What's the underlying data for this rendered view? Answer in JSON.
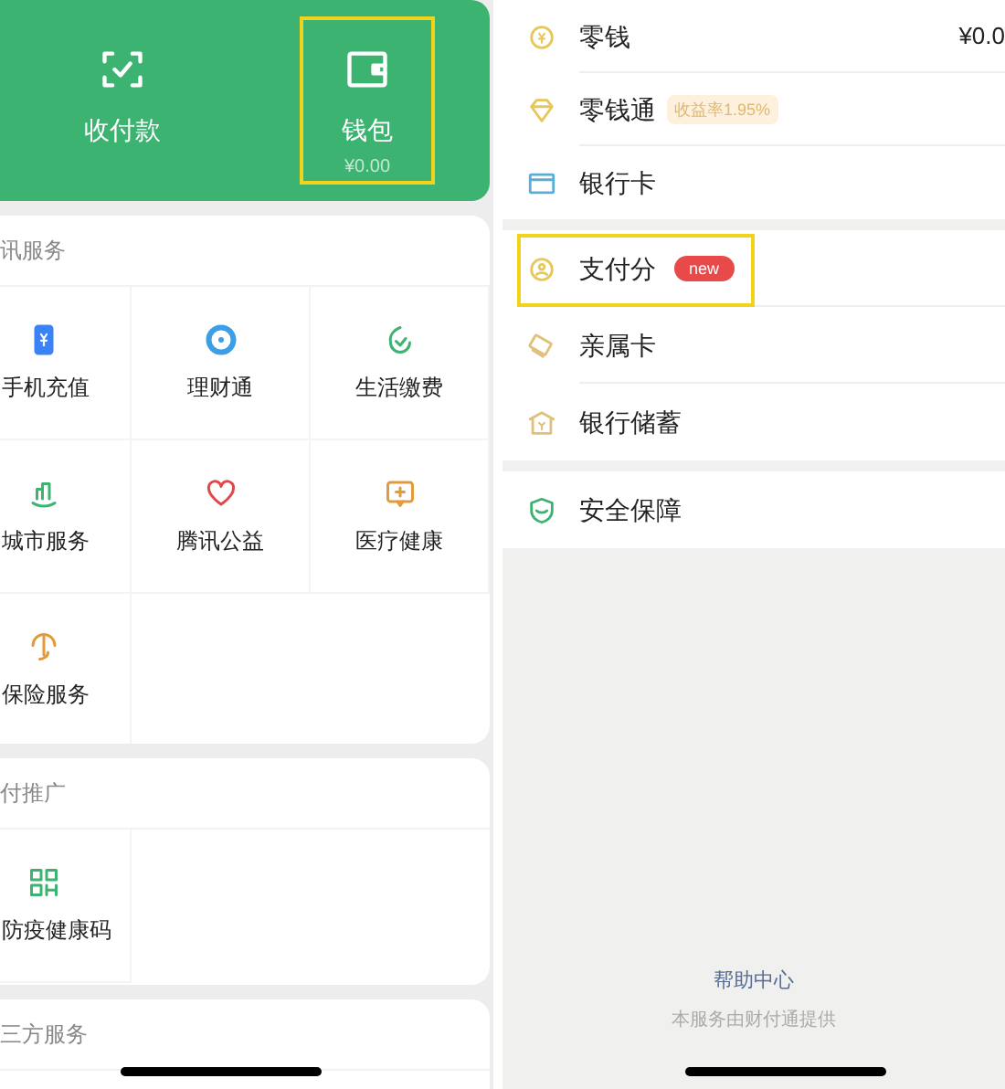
{
  "wallet_card": {
    "items": [
      {
        "label": "收付款",
        "highlighted": false
      },
      {
        "label": "钱包",
        "amount": "¥0.00",
        "highlighted": true
      }
    ]
  },
  "sections": [
    {
      "title": "讯服务",
      "items": [
        {
          "label": "手机充值"
        },
        {
          "label": "理财通"
        },
        {
          "label": "生活缴费"
        },
        {
          "label": "城市服务"
        },
        {
          "label": "腾讯公益"
        },
        {
          "label": "医疗健康"
        },
        {
          "label": "保险服务"
        }
      ]
    },
    {
      "title": "付推广",
      "items": [
        {
          "label": "防疫健康码"
        }
      ]
    },
    {
      "title": "三方服务"
    }
  ],
  "wallet_groups": [
    {
      "rows": [
        {
          "label": "零钱",
          "value": "¥0.0",
          "highlighted": false
        },
        {
          "label": "零钱通",
          "badge": {
            "text": "收益率1.95%",
            "kind": "rate"
          },
          "highlighted": false
        },
        {
          "label": "银行卡",
          "highlighted": false
        }
      ]
    },
    {
      "rows": [
        {
          "label": "支付分",
          "badge": {
            "text": "new",
            "kind": "new"
          },
          "highlighted": true
        },
        {
          "label": "亲属卡",
          "highlighted": false
        },
        {
          "label": "银行储蓄",
          "highlighted": false
        }
      ]
    },
    {
      "rows": [
        {
          "label": "安全保障",
          "highlighted": false
        }
      ]
    }
  ],
  "footer": {
    "help_link": "帮助中心",
    "provider": "本服务由财付通提供"
  }
}
